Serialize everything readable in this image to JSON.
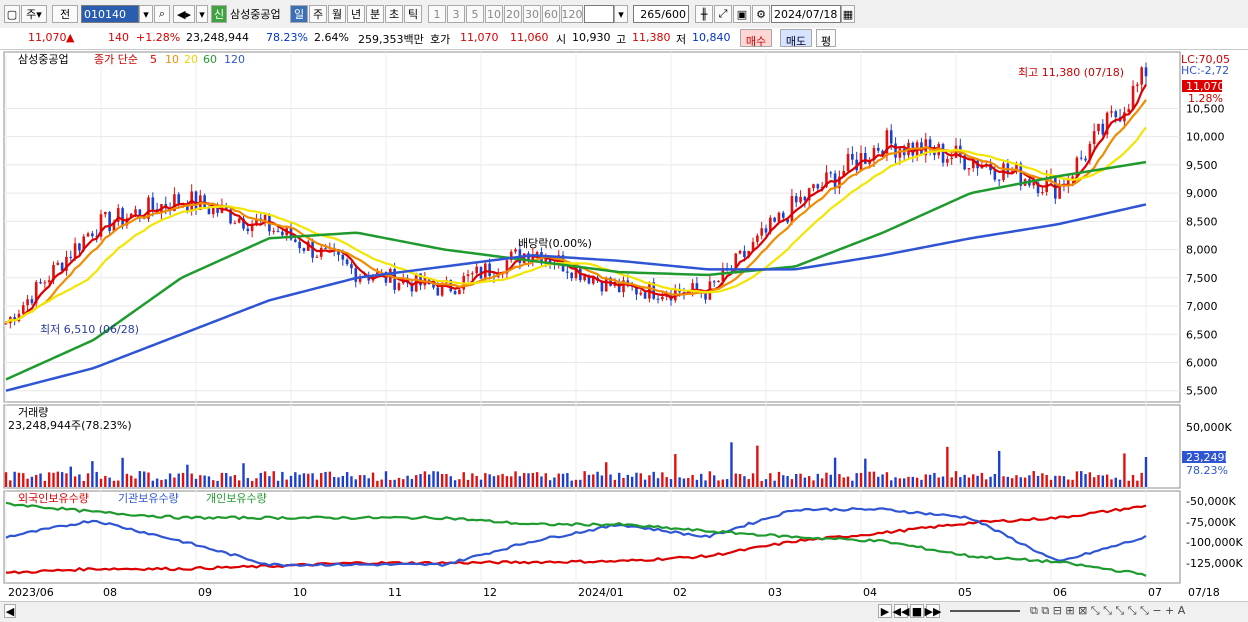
{
  "toolbar": {
    "period_type": "주",
    "range_type": "전",
    "code": "010140",
    "new_badge": "신",
    "name": "삼성중공업",
    "timeframes": [
      "일",
      "주",
      "월",
      "년",
      "분",
      "초",
      "틱"
    ],
    "timeframe_selected": "일",
    "intervals": [
      "1",
      "3",
      "5",
      "10",
      "20",
      "30",
      "60",
      "120"
    ],
    "count": "265",
    "count_total": "/600",
    "date": "2024/07/18"
  },
  "info": {
    "price": "11,070",
    "arrow": "▲",
    "change": "140",
    "change_pct": "+1.28%",
    "volume": "23,248,944",
    "vol_ratio": "78.23%",
    "turnover": "2.64%",
    "amount": "259,353백만",
    "quote_label": "호가",
    "ask": "11,070",
    "bid": "11,060",
    "open_label": "시",
    "open": "10,930",
    "high_label": "고",
    "high": "11,380",
    "low_label": "저",
    "low": "10,840",
    "buy_btn": "매수",
    "sell_btn": "매도",
    "eval_btn": "평"
  },
  "chart_data": {
    "type": "line",
    "title": "삼성중공업",
    "legend": {
      "price_label": "종가 단순",
      "ma": [
        "5",
        "10",
        "20",
        "60",
        "120"
      ],
      "ma_colors": [
        "#dd0000",
        "#f08c00",
        "#f2e600",
        "#1f9a2f",
        "#2f55d4"
      ]
    },
    "price_axis": {
      "ticks": [
        "10,500",
        "10,000",
        "9,500",
        "9,000",
        "8,500",
        "8,000",
        "7,500",
        "7,000",
        "6,500",
        "6,000",
        "5,500"
      ],
      "ylim": [
        5300,
        11500
      ]
    },
    "right_labels": {
      "lc": "LC:70,05",
      "hc": "HC:-2,72",
      "last": "11,070",
      "last_pct": "1.28%"
    },
    "annotations": {
      "high": "최고 11,380 (07/18)",
      "low": "최저 6,510 (06/28)",
      "dividend": "배당락(0.00%)"
    },
    "x_ticks": [
      "2023/06",
      "08",
      "09",
      "10",
      "11",
      "12",
      "2024/01",
      "02",
      "03",
      "04",
      "05",
      "06",
      "07",
      "07/18"
    ],
    "close_monthly": {
      "x": [
        "2023/06",
        "2023/07",
        "2023/08",
        "2023/09",
        "2023/10",
        "2023/11",
        "2023/12",
        "2024/01",
        "2024/02",
        "2024/03",
        "2024/04",
        "2024/05",
        "2024/06",
        "2024/07"
      ],
      "values": [
        6700,
        8400,
        8900,
        8400,
        7600,
        7300,
        8000,
        7300,
        7250,
        8800,
        9900,
        9600,
        9100,
        11070
      ]
    },
    "ma60_monthly": [
      5700,
      6400,
      7500,
      8200,
      8300,
      8000,
      7800,
      7600,
      7550,
      7700,
      8300,
      9000,
      9300,
      9550
    ],
    "ma120_monthly": [
      5500,
      5900,
      6500,
      7100,
      7500,
      7700,
      7900,
      7800,
      7650,
      7650,
      7900,
      8200,
      8450,
      8800
    ],
    "volume": {
      "title": "거래량",
      "current": "23,248,944주(78.23%)",
      "axis": "50,000K",
      "last": "23,249K",
      "last_pct": "78.23%"
    },
    "holdings": {
      "legend": [
        "외국인보유수량",
        "기관보유수량",
        "개인보유수량"
      ],
      "colors": [
        "#dd0000",
        "#2f55d4",
        "#1f9a2f"
      ],
      "axis": [
        "-50,000K",
        "-75,000K",
        "-100,000K",
        "-125,000K"
      ]
    }
  }
}
